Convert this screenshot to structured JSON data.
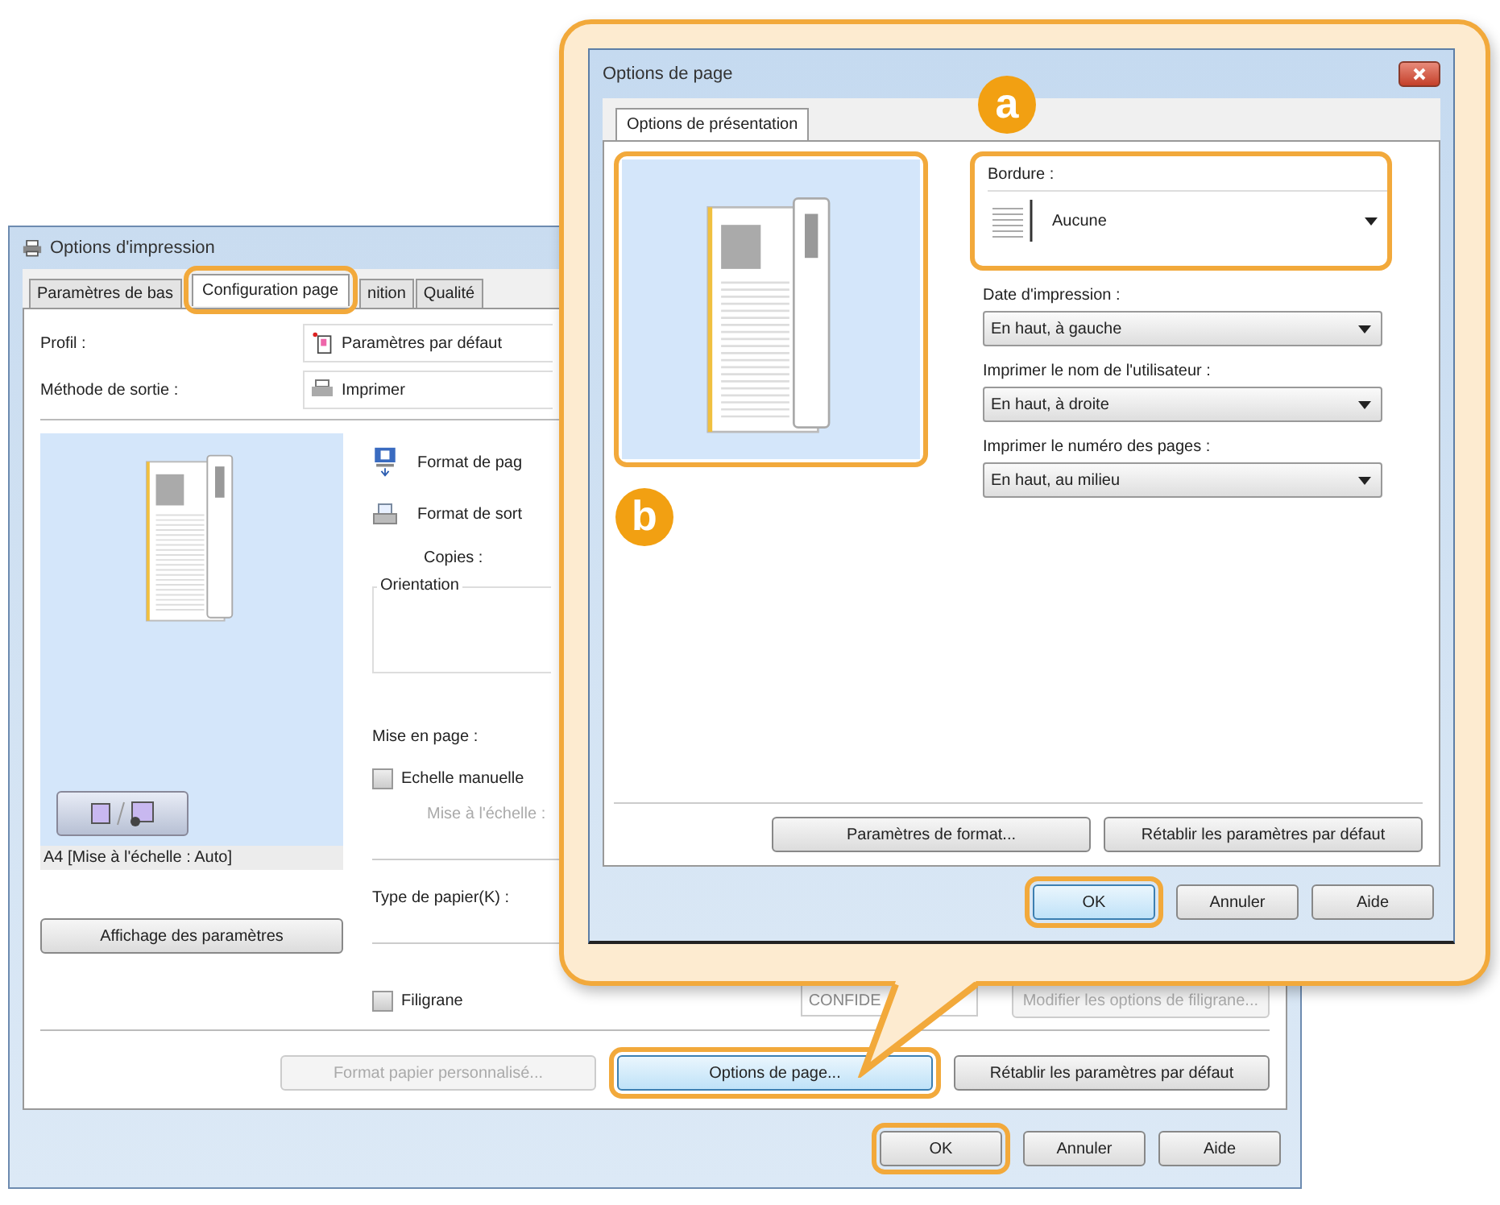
{
  "print_window": {
    "title": "Options d'impression",
    "tabs": [
      {
        "label": "Paramètres de bas",
        "selected": false,
        "highlighted": false
      },
      {
        "label": "Configuration page",
        "selected": true,
        "highlighted": true
      },
      {
        "label": "nition",
        "selected": false,
        "highlighted": false
      },
      {
        "label": "Qualité",
        "selected": false,
        "highlighted": false
      }
    ],
    "profile": {
      "label": "Profil :",
      "value": "Paramètres par défaut"
    },
    "output_method": {
      "label": "Méthode de sortie :",
      "value": "Imprimer"
    },
    "preview_caption": "A4 [Mise à l'échelle : Auto]",
    "display_settings_button": "Affichage des paramètres",
    "page_size_label": "Format de pag",
    "output_size_label": "Format de sort",
    "copies_label": "Copies :",
    "orientation_label": "Orientation",
    "layout_label": "Mise en page :",
    "manual_scaling": {
      "label": "Echelle manuelle",
      "checked": false
    },
    "scaling": {
      "label": "Mise à l'échelle :",
      "disabled": true
    },
    "paper_type_label": "Type de papier(K) :",
    "watermark": {
      "label": "Filigrane",
      "checked": false
    },
    "watermark_select": {
      "value": "CONFIDE",
      "disabled": true
    },
    "watermark_button": {
      "label": "Modifier les options de filigrane...",
      "disabled": true
    },
    "actions": [
      {
        "label": "Format papier personnalisé...",
        "disabled": true,
        "highlighted": false
      },
      {
        "label": "Options de page...",
        "disabled": false,
        "highlighted": true
      },
      {
        "label": "Rétablir les paramètres par défaut",
        "disabled": false,
        "highlighted": false
      }
    ],
    "buttons": [
      {
        "label": "OK",
        "highlighted": true
      },
      {
        "label": "Annuler",
        "highlighted": false
      },
      {
        "label": "Aide",
        "highlighted": false
      }
    ]
  },
  "page_options_dialog": {
    "title": "Options de page",
    "tabs": [
      {
        "label": "Options de présentation",
        "selected": true
      }
    ],
    "preview": {
      "badge": "b",
      "highlighted": true
    },
    "border": {
      "label": "Bordure :",
      "value": "Aucune",
      "badge": "a",
      "highlighted": true
    },
    "fields": [
      {
        "label": "Date d'impression :",
        "value": "En haut, à gauche"
      },
      {
        "label": "Imprimer le nom de l'utilisateur :",
        "value": "En haut, à droite"
      },
      {
        "label": "Imprimer le numéro des pages :",
        "value": "En haut, au milieu"
      }
    ],
    "actions": [
      {
        "label": "Paramètres de format..."
      },
      {
        "label": "Rétablir les paramètres par défaut"
      }
    ],
    "buttons": [
      {
        "label": "OK",
        "highlighted": true
      },
      {
        "label": "Annuler",
        "highlighted": false
      },
      {
        "label": "Aide",
        "highlighted": false
      }
    ]
  }
}
